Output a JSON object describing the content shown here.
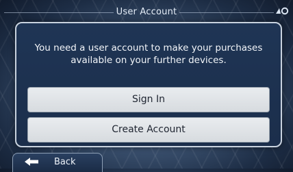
{
  "header": {
    "title": "User Account",
    "corner_icon": "navigation-settings-icon"
  },
  "dialog": {
    "message": "You need a user account to make your purchases available on your further devices.",
    "sign_in_label": "Sign In",
    "create_account_label": "Create Account"
  },
  "footer": {
    "back_label": "Back",
    "back_icon": "back-arrow-icon"
  },
  "colors": {
    "dialog_bg": "#1f3555",
    "button_bg": "#e1e4e8",
    "text_light": "#f3f6fa"
  }
}
